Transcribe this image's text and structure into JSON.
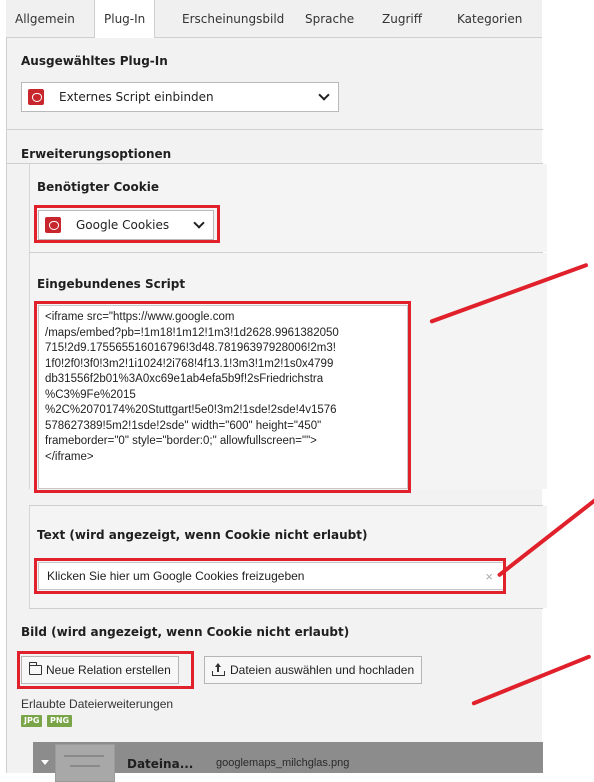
{
  "tabs": [
    "Allgemein",
    "Plug-In",
    "Erscheinungsbild",
    "Sprache",
    "Zugriff",
    "Kategorien"
  ],
  "plugin": {
    "title": "Ausgewähltes Plug-In",
    "selected": "Externes Script einbinden"
  },
  "options": {
    "title": "Erweiterungsoptionen",
    "cookie_title": "Benötigter Cookie",
    "cookie_selected": "Google Cookies",
    "script_title": "Eingebundenes Script",
    "script_value": "<iframe src=\"https://www.google.com\n/maps/embed?pb=!1m18!1m12!1m3!1d2628.9961382050\n715!2d9.175565516016796!3d48.78196397928006!2m3!\n1f0!2f0!3f0!3m2!1i1024!2i768!4f13.1!3m3!1m2!1s0x4799\ndb31556f2b01%3A0xc69e1ab4efa5b9f!2sFriedrichstra\n%C3%9Fe%2015\n%2C%2070174%20Stuttgart!5e0!3m2!1sde!2sde!4v1576\n578627389!5m2!1sde!2sde\" width=\"600\" height=\"450\"\nframeborder=\"0\" style=\"border:0;\" allowfullscreen=\"\">\n</iframe>",
    "text_title": "Text (wird angezeigt, wenn Cookie nicht erlaubt)",
    "text_value": "Klicken Sie hier um Google Cookies freizugeben",
    "clear_symbol": "×",
    "image_title": "Bild (wird angezeigt, wenn Cookie nicht erlaubt)",
    "new_relation_label": "Neue Relation erstellen",
    "upload_label": "Dateien auswählen und hochladen",
    "allowed_ext_label": "Erlaubte Dateierweiterungen",
    "extensions": [
      "JPG",
      "PNG"
    ],
    "file_name_label": "Dateina...",
    "file_name": "googlemaps_milchglas.png"
  },
  "annotation_color": "#e0202a"
}
